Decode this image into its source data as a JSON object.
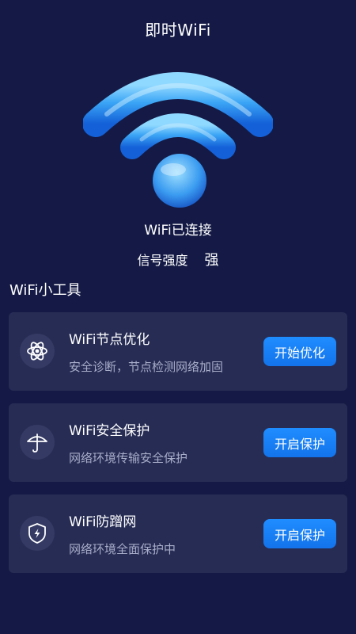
{
  "header": {
    "title": "即时WiFi"
  },
  "connection": {
    "status": "WiFi已连接",
    "signal_label": "信号强度",
    "signal_value": "强"
  },
  "tools": {
    "section_title": "WiFi小工具",
    "items": [
      {
        "title": "WiFi节点优化",
        "desc": "安全诊断，节点检测网络加固",
        "button": "开始优化",
        "icon": "atom-icon"
      },
      {
        "title": "WiFi安全保护",
        "desc": "网络环境传输安全保护",
        "button": "开启保护",
        "icon": "umbrella-icon"
      },
      {
        "title": "WiFi防蹭网",
        "desc": "网络环境全面保护中",
        "button": "开启保护",
        "icon": "shield-bolt-icon"
      }
    ]
  },
  "colors": {
    "background": "#141a45",
    "card": "#262c54",
    "accent": "#1a82f7",
    "wifi_glow": "#4fb3ff"
  }
}
